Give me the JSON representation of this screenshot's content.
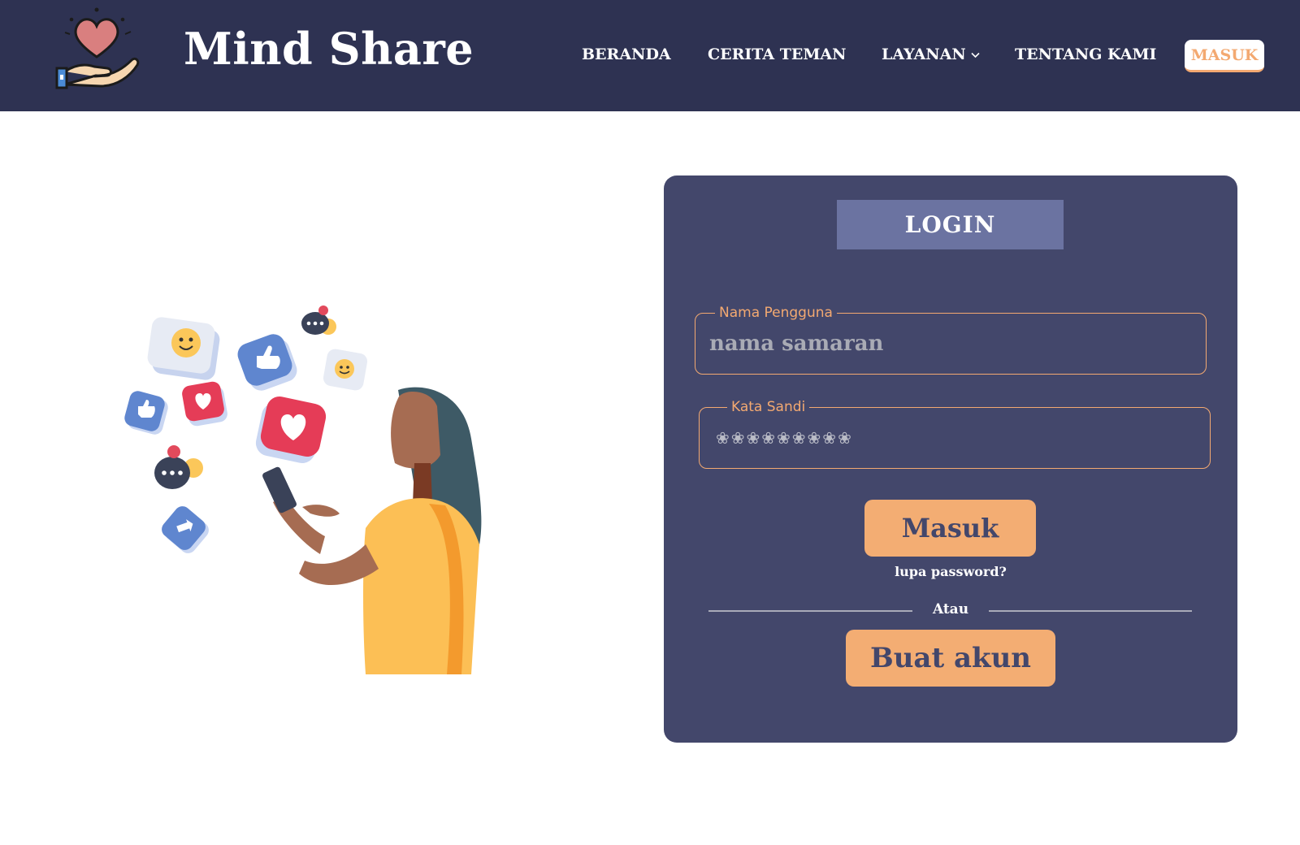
{
  "header": {
    "brand": "Mind Share",
    "nav": [
      {
        "label": "BERANDA"
      },
      {
        "label": "CERITA TEMAN"
      },
      {
        "label": "LAYANAN"
      },
      {
        "label": "TENTANG KAMI"
      }
    ],
    "masuk_label": "MASUK",
    "logo_icon": "heart-hand-icon"
  },
  "login": {
    "title": "LOGIN",
    "username_label": "Nama Pengguna",
    "username_placeholder": "nama samaran",
    "password_label": "Kata Sandi",
    "password_value": "❀❀❀❀❀❀❀❀❀",
    "submit_label": "Masuk",
    "forgot_label": "lupa password?",
    "divider_label": "Atau",
    "register_label": "Buat akun"
  },
  "colors": {
    "navbar_bg": "#2e3252",
    "card_bg": "#43476b",
    "title_bg": "#6b73a1",
    "accent": "#f3ad73"
  }
}
